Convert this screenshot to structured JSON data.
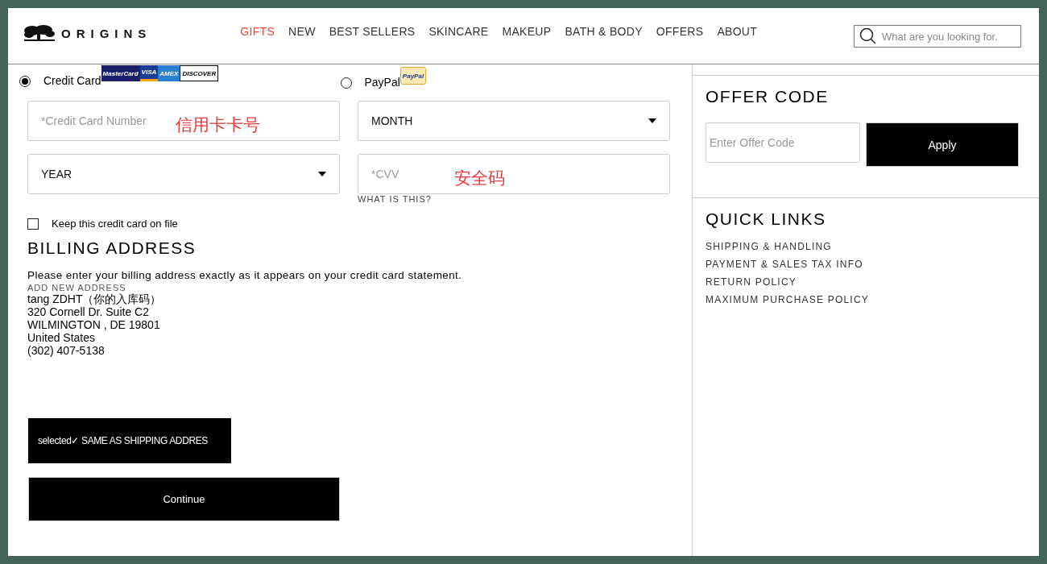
{
  "header": {
    "logo": "ORIGINS",
    "nav": [
      {
        "label": "GIFTS",
        "selected": true
      },
      {
        "label": "NEW",
        "selected": false
      },
      {
        "label": "BEST SELLERS",
        "selected": false
      },
      {
        "label": "SKINCARE",
        "selected": false
      },
      {
        "label": "MAKEUP",
        "selected": false
      },
      {
        "label": "BATH & BODY",
        "selected": false
      },
      {
        "label": "OFFERS",
        "selected": false
      },
      {
        "label": "ABOUT",
        "selected": false
      }
    ],
    "search": {
      "placeholder": "What are you looking for."
    }
  },
  "payment_methods": [
    {
      "label": "Credit Card",
      "selected": true,
      "logos": [
        {
          "text": "MasterCard",
          "kind": "mastercard"
        },
        {
          "text": "VISA",
          "kind": "visa"
        },
        {
          "text": "AMEX",
          "kind": "amex"
        },
        {
          "text": "DISCOVER",
          "kind": "discover"
        }
      ]
    },
    {
      "label": "PayPal",
      "selected": false,
      "logos": [
        {
          "text": "PayPal",
          "kind": "paypal"
        }
      ]
    }
  ],
  "fields": [
    {
      "kind": "input",
      "placeholder": "*Credit Card Number",
      "note": "信用卡卡号"
    },
    {
      "kind": "select",
      "value": "MONTH"
    },
    {
      "kind": "select",
      "value": "YEAR"
    },
    {
      "kind": "input",
      "placeholder": "*CVV",
      "note": "安全码",
      "help": "WHAT IS THIS?"
    }
  ],
  "keep_card": {
    "label": "Keep this credit card on file",
    "checked": false
  },
  "billing": {
    "title": "BILLING ADDRESS",
    "instructions": "Please enter your billing address exactly as it appears on your credit card statement.",
    "add_new": "ADD NEW ADDRESS",
    "address": [
      "tang ZDHT（你的入库码）",
      "320 Cornell Dr. Suite C2",
      "WILMINGTON , DE 19801",
      "United States",
      "(302) 407-5138"
    ],
    "same_as_shipping": "selected✓ SAME AS SHIPPING ADDRES",
    "continue": "Continue"
  },
  "offer_code": {
    "title": "OFFER CODE",
    "placeholder": "Enter Offer Code",
    "button": "Apply"
  },
  "quick_links": {
    "title": "QUICK LINKS",
    "links": [
      "SHIPPING & HANDLING",
      "PAYMENT & SALES TAX INFO",
      "RETURN POLICY",
      "MAXIMUM PURCHASE POLICY"
    ]
  }
}
